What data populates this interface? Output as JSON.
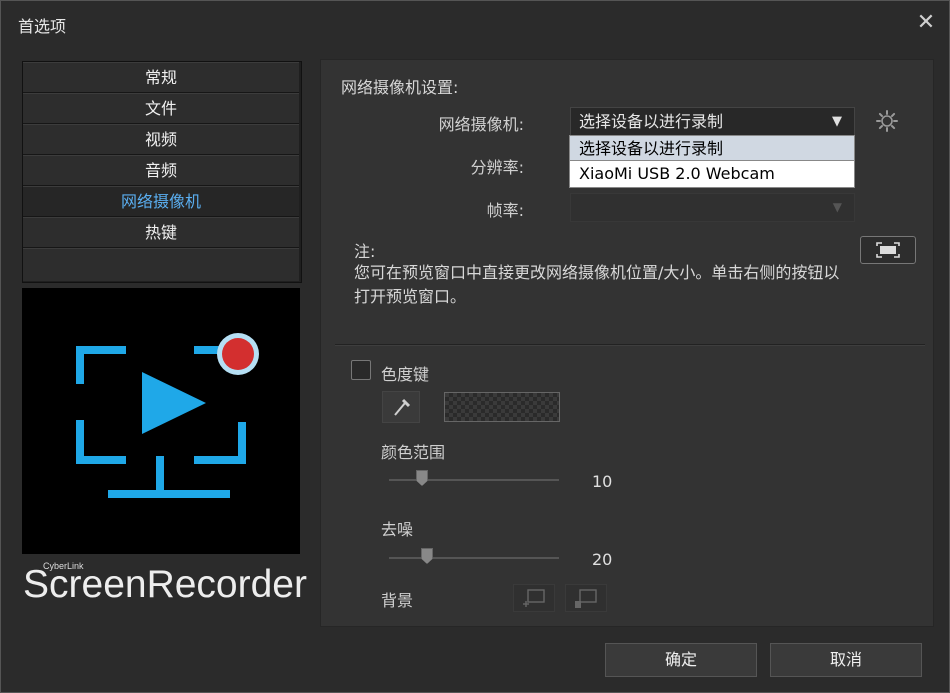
{
  "window": {
    "title": "首选项",
    "close_glyph": "✕"
  },
  "nav": {
    "items": [
      {
        "label": "常规"
      },
      {
        "label": "文件"
      },
      {
        "label": "视频"
      },
      {
        "label": "音频"
      },
      {
        "label": "网络摄像机",
        "active": true
      },
      {
        "label": "热键"
      }
    ]
  },
  "brand": {
    "small": "CyberLink",
    "name": "ScreenRecorder",
    "accent": "#1fa8e8",
    "record_dot": "#d32f2f"
  },
  "webcam": {
    "section_title": "网络摄像机设置:",
    "camera_label": "网络摄像机:",
    "camera_value": "选择设备以进行录制",
    "options": [
      "选择设备以进行录制",
      "XiaoMi USB 2.0 Webcam"
    ],
    "resolution_label": "分辨率:",
    "framerate_label": "帧率:",
    "settings_icon": "gear-icon",
    "note_title": "注:",
    "note_text": "您可在预览窗口中直接更改网络摄像机位置/大小。单击右侧的按钮以打开预览窗口。",
    "preview_icon": "fullscreen-icon"
  },
  "chroma": {
    "label": "色度键",
    "color_range_label": "颜色范围",
    "color_range_value": "10",
    "denoise_label": "去噪",
    "denoise_value": "20",
    "background_label": "背景",
    "eyedropper_icon": "eyedropper-icon"
  },
  "footer": {
    "ok": "确定",
    "cancel": "取消"
  }
}
